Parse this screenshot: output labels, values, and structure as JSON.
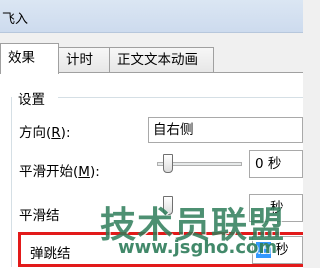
{
  "window": {
    "title": "飞入"
  },
  "tabs": [
    {
      "label": "效果",
      "active": true
    },
    {
      "label": "计时",
      "active": false
    },
    {
      "label": "正文文本动画",
      "active": false
    }
  ],
  "settings": {
    "group_label": "设置",
    "direction": {
      "label_main": "方向(",
      "label_key": "R",
      "label_end": "):",
      "value": "自右侧"
    },
    "smooth_start": {
      "label_main": "平滑开始(",
      "label_key": "M",
      "label_end": "):",
      "value": "0 秒",
      "level": 0
    },
    "smooth_end": {
      "label_main": "平滑结",
      "value": "秒",
      "level": 0
    },
    "bounce_end": {
      "label_main": "弹跳结",
      "value_selected": ".5",
      "value_unit": " 秒"
    }
  },
  "watermark": {
    "text": "技术员联盟",
    "url": "www.jsgho.com"
  },
  "colors": {
    "highlight": "#e21a1a",
    "selection": "#3399ff",
    "watermark": "#2e7d5a"
  }
}
